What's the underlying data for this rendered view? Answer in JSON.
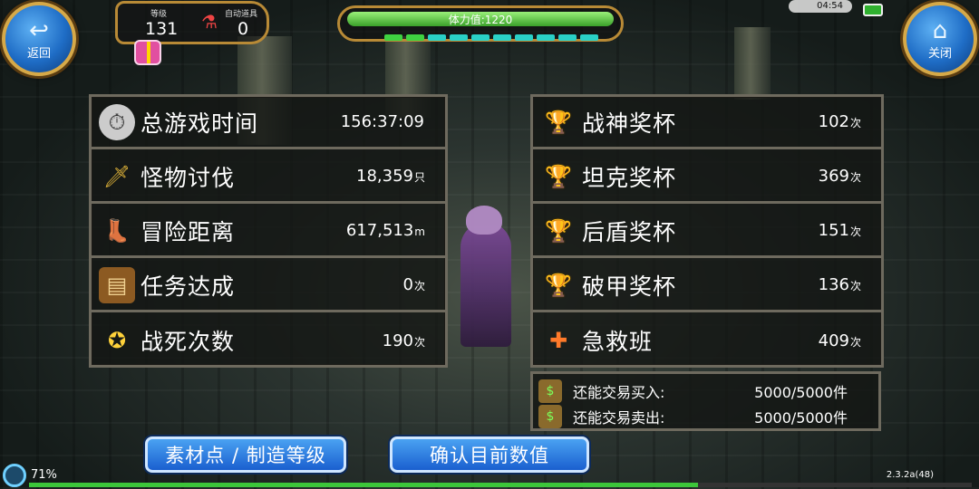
{
  "hud": {
    "back_label": "返回",
    "close_label": "关闭",
    "level_label": "等级",
    "level_value": "131",
    "auto_item_label": "自动道具",
    "auto_item_value": "0",
    "stamina_label": "体力值:1220",
    "time": "04:54"
  },
  "left_stats": [
    {
      "label": "总游戏时间",
      "value": "156:37:09",
      "unit": "",
      "icon": "stopwatch-icon"
    },
    {
      "label": "怪物讨伐",
      "value": "18,359",
      "unit": "只",
      "icon": "sword-icon"
    },
    {
      "label": "冒险距离",
      "value": "617,513",
      "unit": "m",
      "icon": "boots-icon"
    },
    {
      "label": "任务达成",
      "value": "0",
      "unit": "次",
      "icon": "quest-book-icon"
    },
    {
      "label": "战死次数",
      "value": "190",
      "unit": "次",
      "icon": "revive-stars-icon"
    }
  ],
  "right_stats": [
    {
      "label": "战神奖杯",
      "value": "102",
      "unit": "次",
      "icon": "trophy-swords-icon"
    },
    {
      "label": "坦克奖杯",
      "value": "369",
      "unit": "次",
      "icon": "trophy-shield-icon"
    },
    {
      "label": "后盾奖杯",
      "value": "151",
      "unit": "次",
      "icon": "trophy-support-icon"
    },
    {
      "label": "破甲奖杯",
      "value": "136",
      "unit": "次",
      "icon": "trophy-armor-break-icon"
    },
    {
      "label": "急救班",
      "value": "409",
      "unit": "次",
      "icon": "first-aid-icon"
    }
  ],
  "trade": [
    {
      "label": "还能交易买入:",
      "value": "5000/5000件"
    },
    {
      "label": "还能交易卖出:",
      "value": "5000/5000件"
    }
  ],
  "buttons": {
    "materials_label": "素材点 / 制造等级",
    "confirm_label": "确认目前数值"
  },
  "footer": {
    "percent": "71%",
    "version": "2.3.2a(48)",
    "xp_fraction": 0.71
  }
}
